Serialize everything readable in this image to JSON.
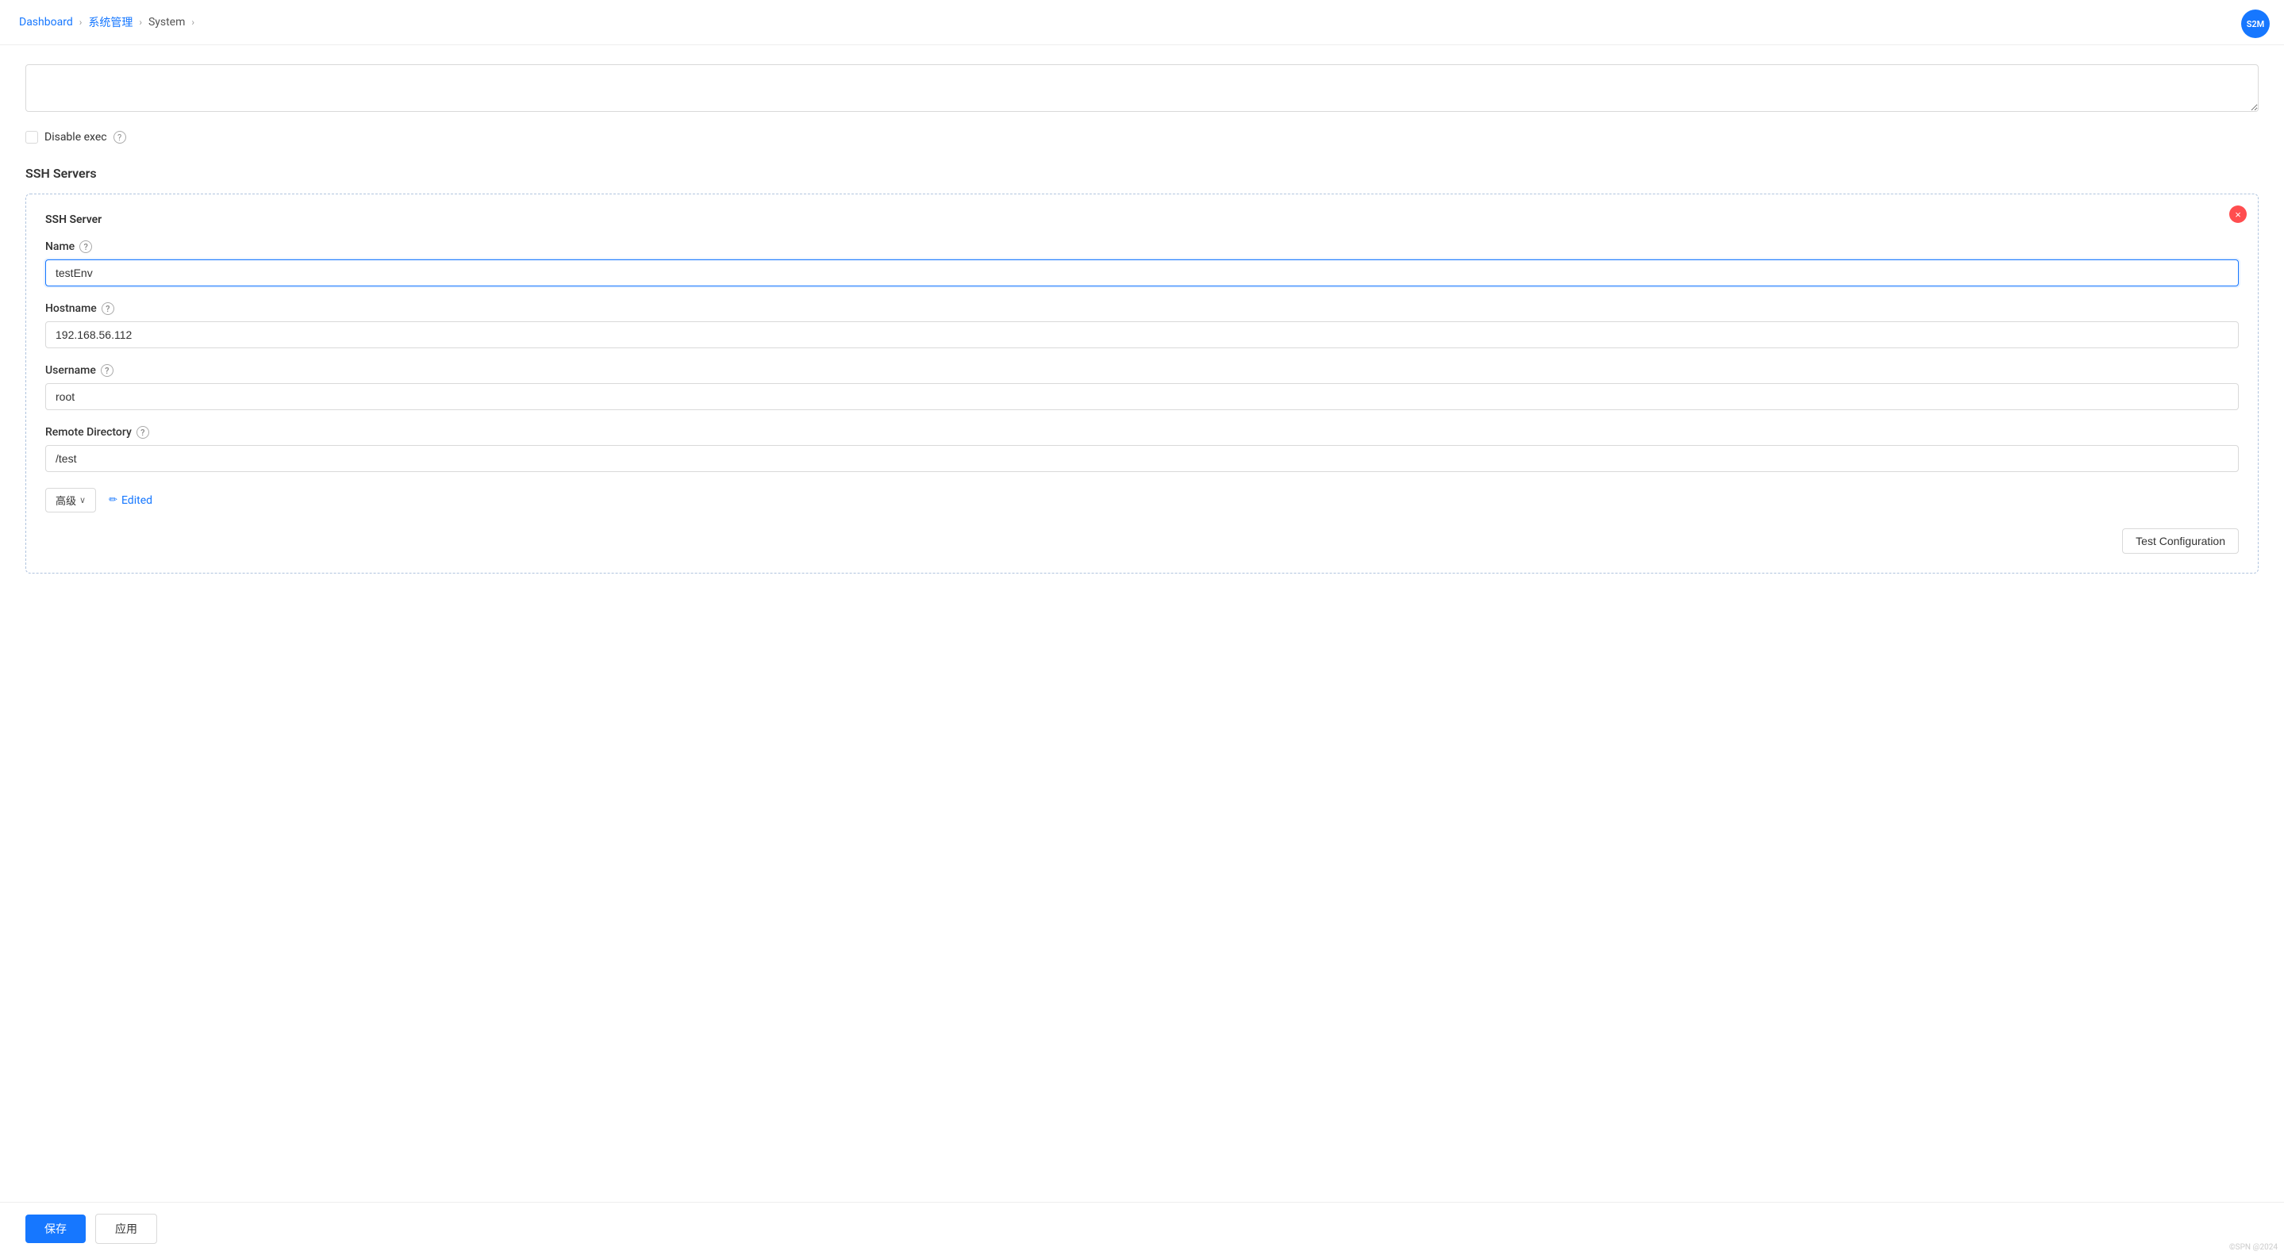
{
  "breadcrumb": {
    "items": [
      {
        "label": "Dashboard",
        "active": true
      },
      {
        "label": "系统管理",
        "active": true
      },
      {
        "label": "System",
        "active": false
      }
    ],
    "separators": [
      "›",
      "›",
      "›"
    ]
  },
  "disable_exec": {
    "label": "Disable exec",
    "checked": false,
    "help_icon": "?"
  },
  "ssh_servers": {
    "section_title": "SSH Servers",
    "card": {
      "subtitle": "SSH Server",
      "close_icon": "×",
      "name_label": "Name",
      "name_help": "?",
      "name_value": "testEnv",
      "hostname_label": "Hostname",
      "hostname_help": "?",
      "hostname_value": "192.168.56.112",
      "username_label": "Username",
      "username_help": "?",
      "username_value": "root",
      "remote_dir_label": "Remote Directory",
      "remote_dir_help": "?",
      "remote_dir_value": "/test",
      "advanced_btn": "高级",
      "edited_label": "Edited",
      "pencil_icon": "✏",
      "chevron_icon": "∨",
      "test_config_btn": "Test Configuration"
    }
  },
  "bottom_bar": {
    "save_label": "保存",
    "apply_label": "应用"
  },
  "avatar": {
    "label": "S2M"
  },
  "copyright": "©SPN @2024"
}
